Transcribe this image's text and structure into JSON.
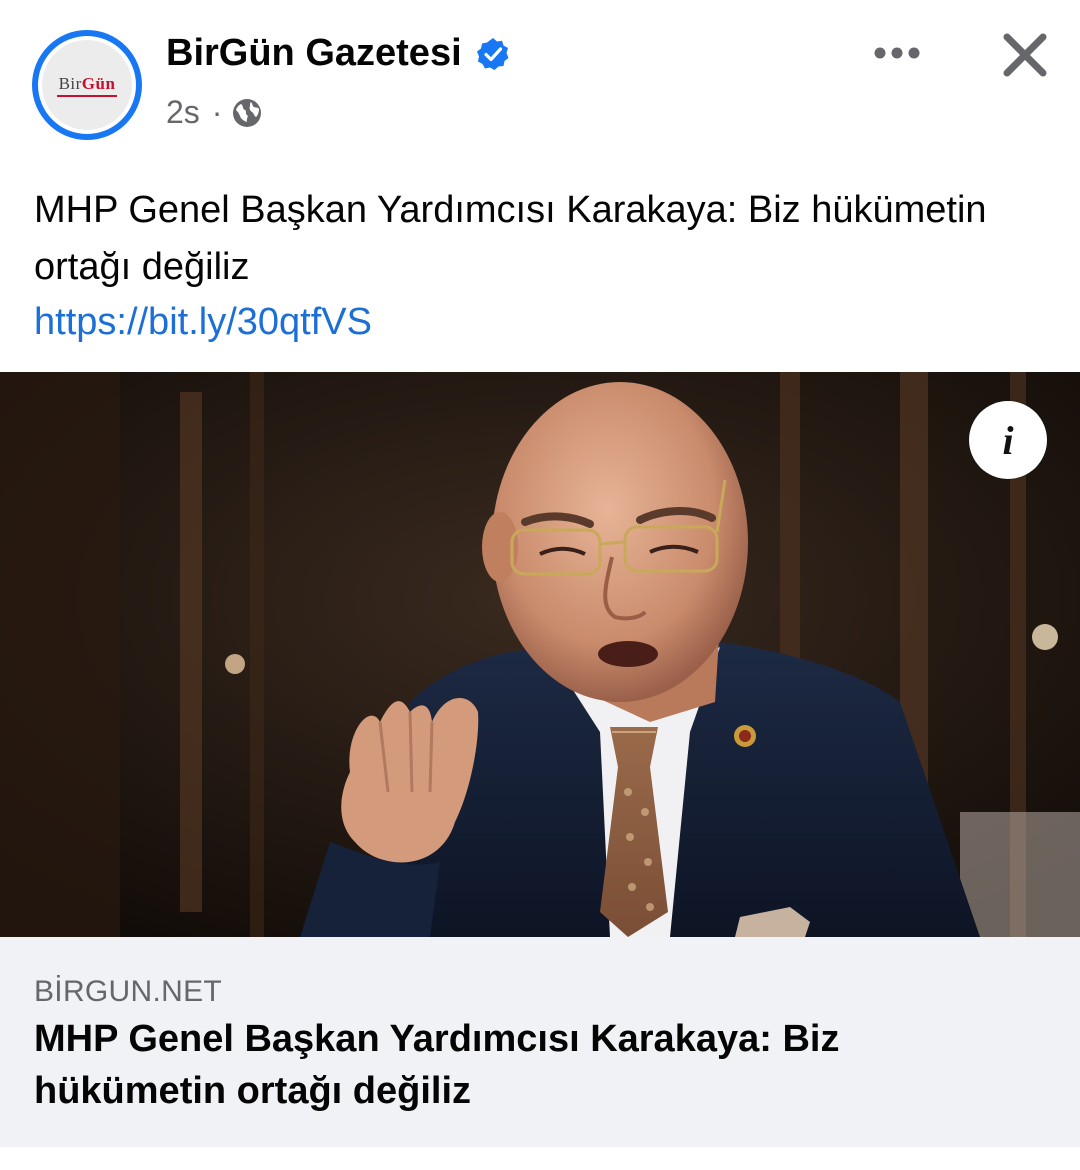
{
  "header": {
    "page_name": "BirGün Gazetesi",
    "avatar_logo": {
      "part1": "Bir",
      "part2": "Gün"
    },
    "timestamp": "2s",
    "separator": "·",
    "audience_icon": "globe-icon",
    "verified_icon": "verified-badge-icon",
    "more_icon": "more-horizontal-icon",
    "close_icon": "close-icon"
  },
  "post": {
    "text": "MHP Genel Başkan Yardımcısı Karakaya: Biz hükümetin ortağı değiliz",
    "link": "https://bit.ly/30qtfVS"
  },
  "image": {
    "info_label": "i"
  },
  "preview": {
    "domain": "BİRGUN.NET",
    "title": "MHP Genel Başkan Yardımcısı Karakaya: Biz hükümetin ortağı değiliz"
  },
  "colors": {
    "brand_blue": "#1877f2",
    "link_blue": "#1b6fd6",
    "secondary_text": "#65676b",
    "preview_bg": "#f0f2f5",
    "logo_red": "#c8102e"
  }
}
